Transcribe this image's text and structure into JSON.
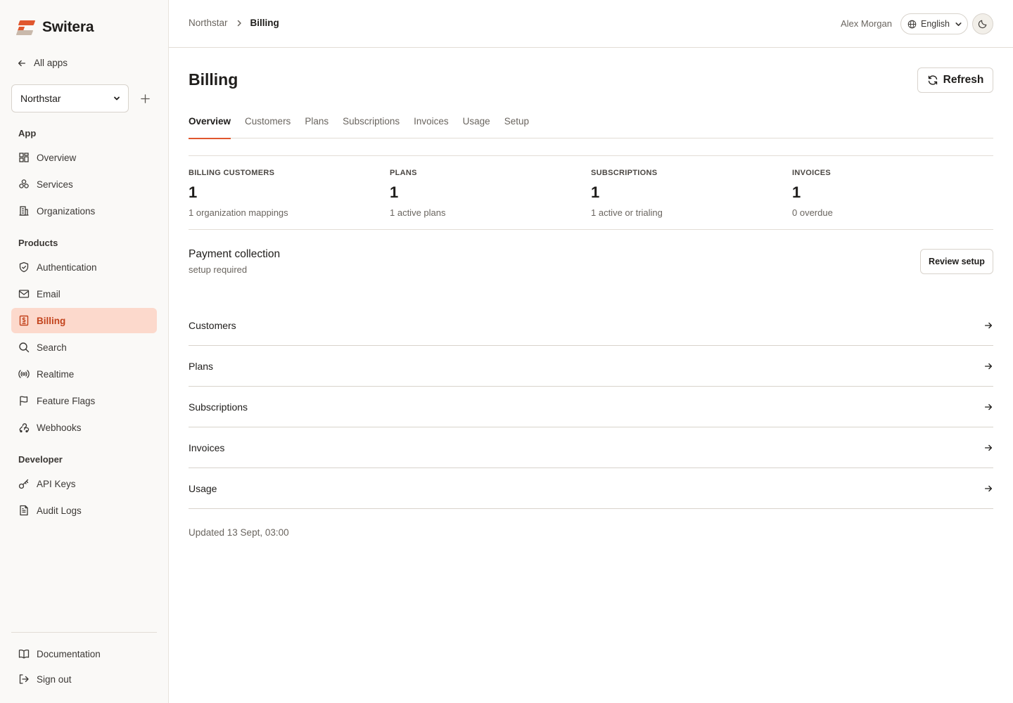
{
  "brand": {
    "name": "Switera"
  },
  "sidebar": {
    "all_apps": "All apps",
    "app_select": "Northstar",
    "sections": {
      "app": "App",
      "products": "Products",
      "developer": "Developer"
    },
    "app_items": [
      {
        "label": "Overview",
        "icon": "grid-icon"
      },
      {
        "label": "Services",
        "icon": "services-icon"
      },
      {
        "label": "Organizations",
        "icon": "building-icon"
      }
    ],
    "product_items": [
      {
        "label": "Authentication",
        "icon": "shield-icon"
      },
      {
        "label": "Email",
        "icon": "mail-icon"
      },
      {
        "label": "Billing",
        "icon": "billing-icon",
        "active": true
      },
      {
        "label": "Search",
        "icon": "search-icon"
      },
      {
        "label": "Realtime",
        "icon": "broadcast-icon"
      },
      {
        "label": "Feature Flags",
        "icon": "flag-icon"
      },
      {
        "label": "Webhooks",
        "icon": "webhook-icon"
      }
    ],
    "developer_items": [
      {
        "label": "API Keys",
        "icon": "key-icon"
      },
      {
        "label": "Audit Logs",
        "icon": "file-icon"
      }
    ],
    "footer_items": [
      {
        "label": "Documentation",
        "icon": "book-icon"
      },
      {
        "label": "Sign out",
        "icon": "sign-out-icon"
      }
    ]
  },
  "header": {
    "breadcrumb": [
      "Northstar",
      "Billing"
    ],
    "user": "Alex Morgan",
    "language": "English"
  },
  "page": {
    "title": "Billing",
    "refresh_label": "Refresh",
    "tabs": [
      "Overview",
      "Customers",
      "Plans",
      "Subscriptions",
      "Invoices",
      "Usage",
      "Setup"
    ],
    "active_tab": "Overview",
    "stats": [
      {
        "label": "Billing customers",
        "value": "1",
        "sub": "1 organization mappings"
      },
      {
        "label": "Plans",
        "value": "1",
        "sub": "1 active plans"
      },
      {
        "label": "Subscriptions",
        "value": "1",
        "sub": "1 active or trialing"
      },
      {
        "label": "Invoices",
        "value": "1",
        "sub": "0 overdue"
      }
    ],
    "payment": {
      "title": "Payment collection",
      "status": "setup required",
      "action": "Review setup"
    },
    "links": [
      "Customers",
      "Plans",
      "Subscriptions",
      "Invoices",
      "Usage"
    ],
    "updated": "Updated 13 Sept, 03:00"
  },
  "colors": {
    "accent": "#e0572e",
    "active_bg": "#fcd9cc",
    "active_text": "#c2431c"
  }
}
